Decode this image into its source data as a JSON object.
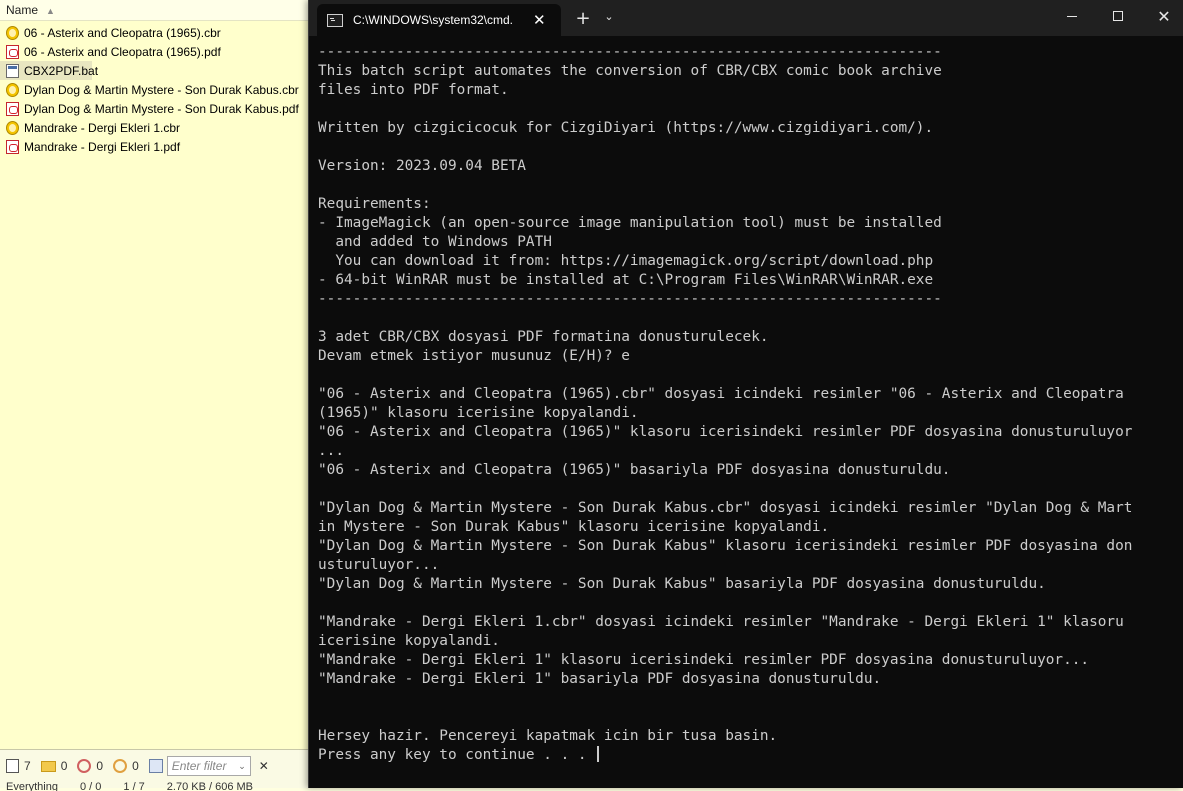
{
  "explorer": {
    "column_header": "Name",
    "files": [
      {
        "name": "06 - Asterix and Cleopatra (1965).cbr",
        "type": "cbr"
      },
      {
        "name": "06 - Asterix and Cleopatra (1965).pdf",
        "type": "pdf"
      },
      {
        "name": "CBX2PDF.bat",
        "type": "bat",
        "selected": true
      },
      {
        "name": "Dylan Dog & Martin Mystere - Son Durak Kabus.cbr",
        "type": "cbr"
      },
      {
        "name": "Dylan Dog & Martin Mystere - Son Durak Kabus.pdf",
        "type": "pdf"
      },
      {
        "name": "Mandrake - Dergi Ekleri 1.cbr",
        "type": "cbr"
      },
      {
        "name": "Mandrake - Dergi Ekleri 1.pdf",
        "type": "pdf"
      }
    ],
    "status": {
      "file_count": "7",
      "folder_count": "0",
      "hidden_count": "0",
      "system_count": "0",
      "filter_placeholder": "Enter filter",
      "row2_left": "Everything",
      "row2_sel": "0 / 0",
      "row2_count": "1 / 7",
      "row2_size": "2.70 KB / 606 MB"
    }
  },
  "terminal": {
    "tab_title": "C:\\WINDOWS\\system32\\cmd.",
    "lines": [
      "------------------------------------------------------------------------",
      "This batch script automates the conversion of CBR/CBX comic book archive",
      "files into PDF format.",
      "",
      "Written by cizgicicocuk for CizgiDiyari (https://www.cizgidiyari.com/).",
      "",
      "Version: 2023.09.04 BETA",
      "",
      "Requirements:",
      "- ImageMagick (an open-source image manipulation tool) must be installed",
      "  and added to Windows PATH",
      "  You can download it from: https://imagemagick.org/script/download.php",
      "- 64-bit WinRAR must be installed at C:\\Program Files\\WinRAR\\WinRAR.exe",
      "------------------------------------------------------------------------",
      "",
      "3 adet CBR/CBX dosyasi PDF formatina donusturulecek.",
      "Devam etmek istiyor musunuz (E/H)? e",
      "",
      "\"06 - Asterix and Cleopatra (1965).cbr\" dosyasi icindeki resimler \"06 - Asterix and Cleopatra",
      "(1965)\" klasoru icerisine kopyalandi.",
      "\"06 - Asterix and Cleopatra (1965)\" klasoru icerisindeki resimler PDF dosyasina donusturuluyor",
      "...",
      "\"06 - Asterix and Cleopatra (1965)\" basariyla PDF dosyasina donusturuldu.",
      "",
      "\"Dylan Dog & Martin Mystere - Son Durak Kabus.cbr\" dosyasi icindeki resimler \"Dylan Dog & Mart",
      "in Mystere - Son Durak Kabus\" klasoru icerisine kopyalandi.",
      "\"Dylan Dog & Martin Mystere - Son Durak Kabus\" klasoru icerisindeki resimler PDF dosyasina don",
      "usturuluyor...",
      "\"Dylan Dog & Martin Mystere - Son Durak Kabus\" basariyla PDF dosyasina donusturuldu.",
      "",
      "\"Mandrake - Dergi Ekleri 1.cbr\" dosyasi icindeki resimler \"Mandrake - Dergi Ekleri 1\" klasoru",
      "icerisine kopyalandi.",
      "\"Mandrake - Dergi Ekleri 1\" klasoru icerisindeki resimler PDF dosyasina donusturuluyor...",
      "\"Mandrake - Dergi Ekleri 1\" basariyla PDF dosyasina donusturuldu.",
      "",
      "",
      "Hersey hazir. Pencereyi kapatmak icin bir tusa basin."
    ],
    "prompt_line": "Press any key to continue . . . "
  },
  "colors": {
    "explorer_bg": "#ffffcc",
    "terminal_bg": "#0c0c0c",
    "terminal_fg": "#cccccc",
    "titlebar_bg": "#202020"
  }
}
